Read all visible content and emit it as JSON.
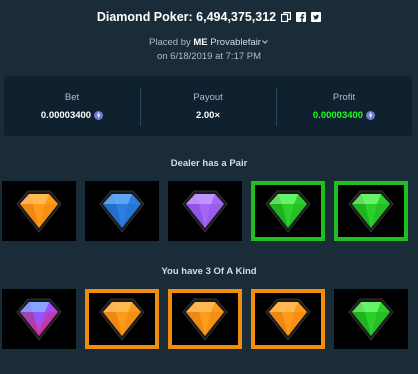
{
  "header": {
    "title": "Diamond Poker: 6,494,375,312",
    "icons": [
      "copy-icon",
      "facebook-icon",
      "twitter-icon"
    ]
  },
  "bet_info": {
    "placed_by_prefix": "Placed by",
    "user_prefix": "ME",
    "username": "Provablefair",
    "date_line": "on 6/18/2019 at 7:17 PM"
  },
  "stats": {
    "bet_label": "Bet",
    "bet_value": "0.00003400",
    "payout_label": "Payout",
    "payout_value": "2.00×",
    "profit_label": "Profit",
    "profit_value": "0.00003400",
    "coin_icon": "eth-icon"
  },
  "dealer": {
    "title": "Dealer has a Pair",
    "gems": [
      {
        "color": "orange",
        "highlighted": false
      },
      {
        "color": "blue",
        "highlighted": false
      },
      {
        "color": "purple",
        "highlighted": false
      },
      {
        "color": "green",
        "highlighted": true
      },
      {
        "color": "green",
        "highlighted": true
      }
    ]
  },
  "player": {
    "title": "You have 3 Of A Kind",
    "gems": [
      {
        "color": "multicolor",
        "highlighted": false
      },
      {
        "color": "orange",
        "highlighted": true
      },
      {
        "color": "orange",
        "highlighted": true
      },
      {
        "color": "orange",
        "highlighted": true
      },
      {
        "color": "green",
        "highlighted": false
      }
    ]
  },
  "colors": {
    "background": "#1a2c38",
    "panel": "#0f212e",
    "profit_green": "#1fff20",
    "highlight_green": "#1fbf1f",
    "highlight_orange": "#f28c0f",
    "gem_orange": "#ff9a1a",
    "gem_blue": "#2a7fe0",
    "gem_purple": "#a466f5",
    "gem_green": "#2bd12b"
  }
}
